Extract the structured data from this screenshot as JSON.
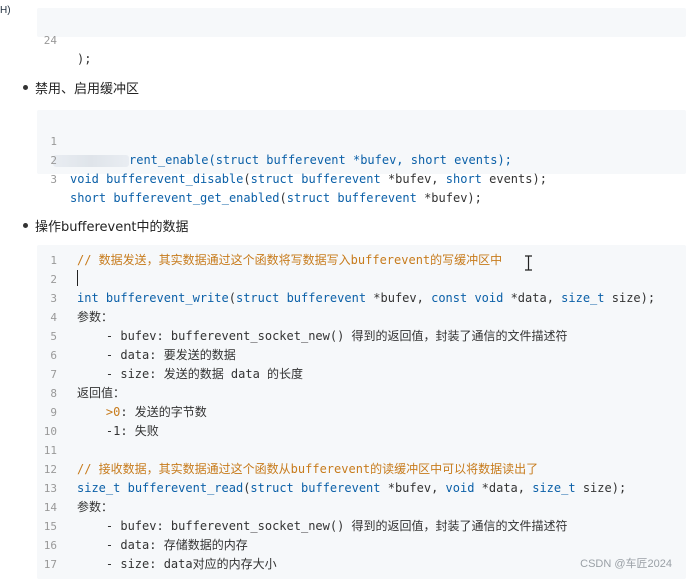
{
  "corner_fragment": "H)",
  "block0": {
    "lines": [
      {
        "n": "24",
        "text": ");"
      }
    ]
  },
  "section1": {
    "title": "禁用、启用缓冲区"
  },
  "block1": {
    "lines": [
      {
        "n": "1",
        "tail": "rent_enable(struct bufferevent *bufev, short events);"
      },
      {
        "n": "2",
        "text": "void bufferevent_disable(struct bufferevent *bufev, short events);"
      },
      {
        "n": "3",
        "text": "short bufferevent_get_enabled(struct bufferevent *bufev);"
      }
    ]
  },
  "section2": {
    "title": "操作bufferevent中的数据"
  },
  "block2": {
    "lines": [
      {
        "n": "1",
        "text": "// 数据发送，其实数据通过这个函数将写数据写入bufferevent的写缓冲区中",
        "kind": "comment"
      },
      {
        "n": "2",
        "text": "",
        "kind": "plain"
      },
      {
        "n": "3",
        "text": "int bufferevent_write(struct bufferevent *bufev, const void *data, size_t size);",
        "kind": "code"
      },
      {
        "n": "4",
        "text": "参数：",
        "kind": "plain"
      },
      {
        "n": "5",
        "text": "    - bufev: bufferevent_socket_new() 得到的返回值，封装了通信的文件描述符",
        "kind": "plain"
      },
      {
        "n": "6",
        "text": "    - data: 要发送的数据",
        "kind": "plain"
      },
      {
        "n": "7",
        "text": "    - size: 发送的数据 data 的长度",
        "kind": "plain"
      },
      {
        "n": "8",
        "text": "返回值：",
        "kind": "plain"
      },
      {
        "n": "9",
        "text": "    >0: 发送的字节数",
        "kind": "plain"
      },
      {
        "n": "10",
        "text": "    -1: 失败",
        "kind": "plain"
      },
      {
        "n": "11",
        "text": "",
        "kind": "plain"
      },
      {
        "n": "12",
        "text": "// 接收数据，其实数据通过这个函数从bufferevent的读缓冲区中可以将数据读出了",
        "kind": "comment"
      },
      {
        "n": "13",
        "text": "size_t bufferevent_read(struct bufferevent *bufev, void *data, size_t size);",
        "kind": "code"
      },
      {
        "n": "14",
        "text": "参数：",
        "kind": "plain"
      },
      {
        "n": "15",
        "text": "    - bufev: bufferevent_socket_new() 得到的返回值，封装了通信的文件描述符",
        "kind": "plain"
      },
      {
        "n": "16",
        "text": "    - data: 存储数据的内存",
        "kind": "plain"
      },
      {
        "n": "17",
        "text": "    - size: data对应的内存大小",
        "kind": "plain"
      }
    ]
  },
  "watermark": "CSDN @车匠2024",
  "colors": {
    "keyword": "#0b60a8",
    "comment": "#c77b1c",
    "code_bg": "#f6f8fa"
  }
}
